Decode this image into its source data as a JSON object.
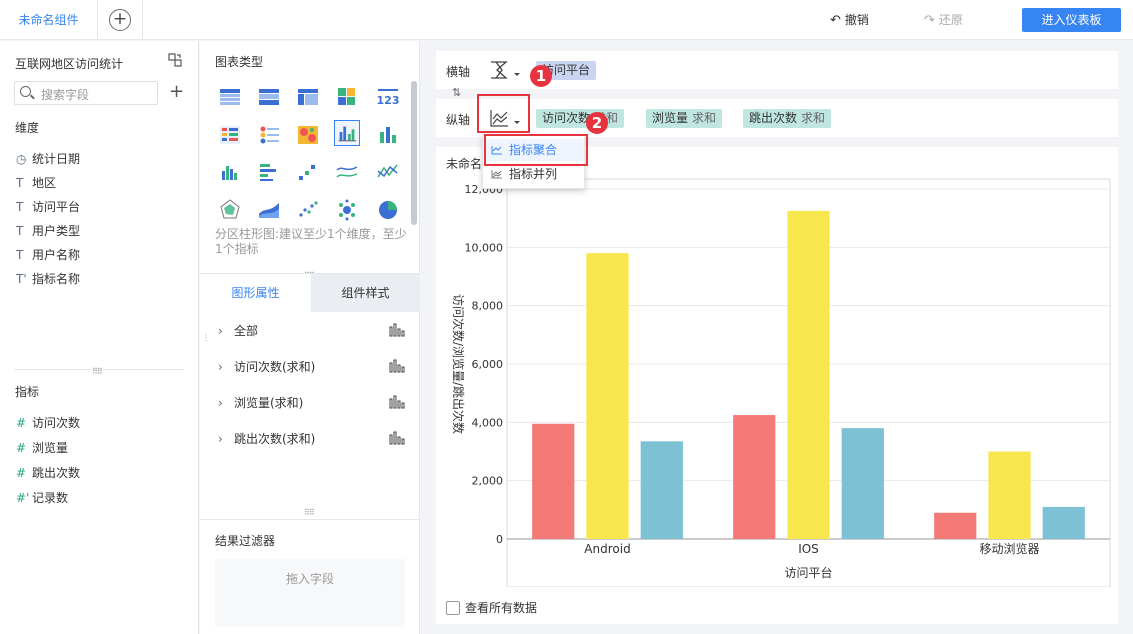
{
  "topbar": {
    "component_tab": "未命名组件",
    "add": "+",
    "undo": "撤销",
    "redo": "还原",
    "enter_dashboard": "进入仪表板"
  },
  "fields": {
    "dataset_title": "互联网地区访问统计",
    "search_placeholder": "搜索字段",
    "add": "+",
    "dimension_label": "维度",
    "dimensions": [
      {
        "icon": "◷",
        "label": "统计日期"
      },
      {
        "icon": "T",
        "label": "地区"
      },
      {
        "icon": "T",
        "label": "访问平台"
      },
      {
        "icon": "T",
        "label": "用户类型"
      },
      {
        "icon": "T",
        "label": "用户名称"
      },
      {
        "icon": "T'",
        "label": "指标名称"
      }
    ],
    "measure_label": "指标",
    "measures": [
      {
        "icon": "#",
        "label": "访问次数"
      },
      {
        "icon": "#",
        "label": "浏览量"
      },
      {
        "icon": "#",
        "label": "跳出次数"
      },
      {
        "icon": "#'",
        "label": "记录数"
      }
    ]
  },
  "chart_types": {
    "title": "图表类型",
    "description": "分区柱形图:建议至少1个维度，至少1个指标",
    "tabs": [
      "图形属性",
      "组件样式"
    ],
    "attributes": [
      "全部",
      "访问次数(求和)",
      "浏览量(求和)",
      "跳出次数(求和)"
    ],
    "filter_title": "结果过滤器",
    "filter_drop": "拖入字段"
  },
  "axes": {
    "x_label": "横轴",
    "y_label": "纵轴",
    "x_pills": [
      {
        "field": "访问平台",
        "agg": ""
      }
    ],
    "y_pills": [
      {
        "field": "访问次数",
        "agg": "求和"
      },
      {
        "field": "浏览量",
        "agg": "求和"
      },
      {
        "field": "跳出次数",
        "agg": "求和"
      }
    ]
  },
  "dropdown": {
    "items": [
      "指标聚合",
      "指标并列"
    ],
    "active": 0
  },
  "badges": [
    "1",
    "2"
  ],
  "chart": {
    "title": "未命名组件",
    "show_all": "查看所有数据"
  },
  "colors": {
    "accent": "#3685f2",
    "series": [
      "#f47a78",
      "#f8e64f",
      "#7cc1d4"
    ],
    "highlight": "#e6333d"
  },
  "chart_data": {
    "type": "bar",
    "categories": [
      "Android",
      "IOS",
      "移动浏览器"
    ],
    "series": [
      {
        "values": [
          3950,
          4250,
          900
        ]
      },
      {
        "values": [
          9800,
          11250,
          3000
        ]
      },
      {
        "values": [
          3350,
          3800,
          1100
        ]
      }
    ],
    "xlabel": "访问平台",
    "ylabel": "访问次数/浏览量/跳出次数",
    "ylim": [
      0,
      12000
    ],
    "yticks": [
      "0",
      "2,000",
      "4,000",
      "6,000",
      "8,000",
      "10,000",
      "12,000"
    ],
    "grid": true
  }
}
